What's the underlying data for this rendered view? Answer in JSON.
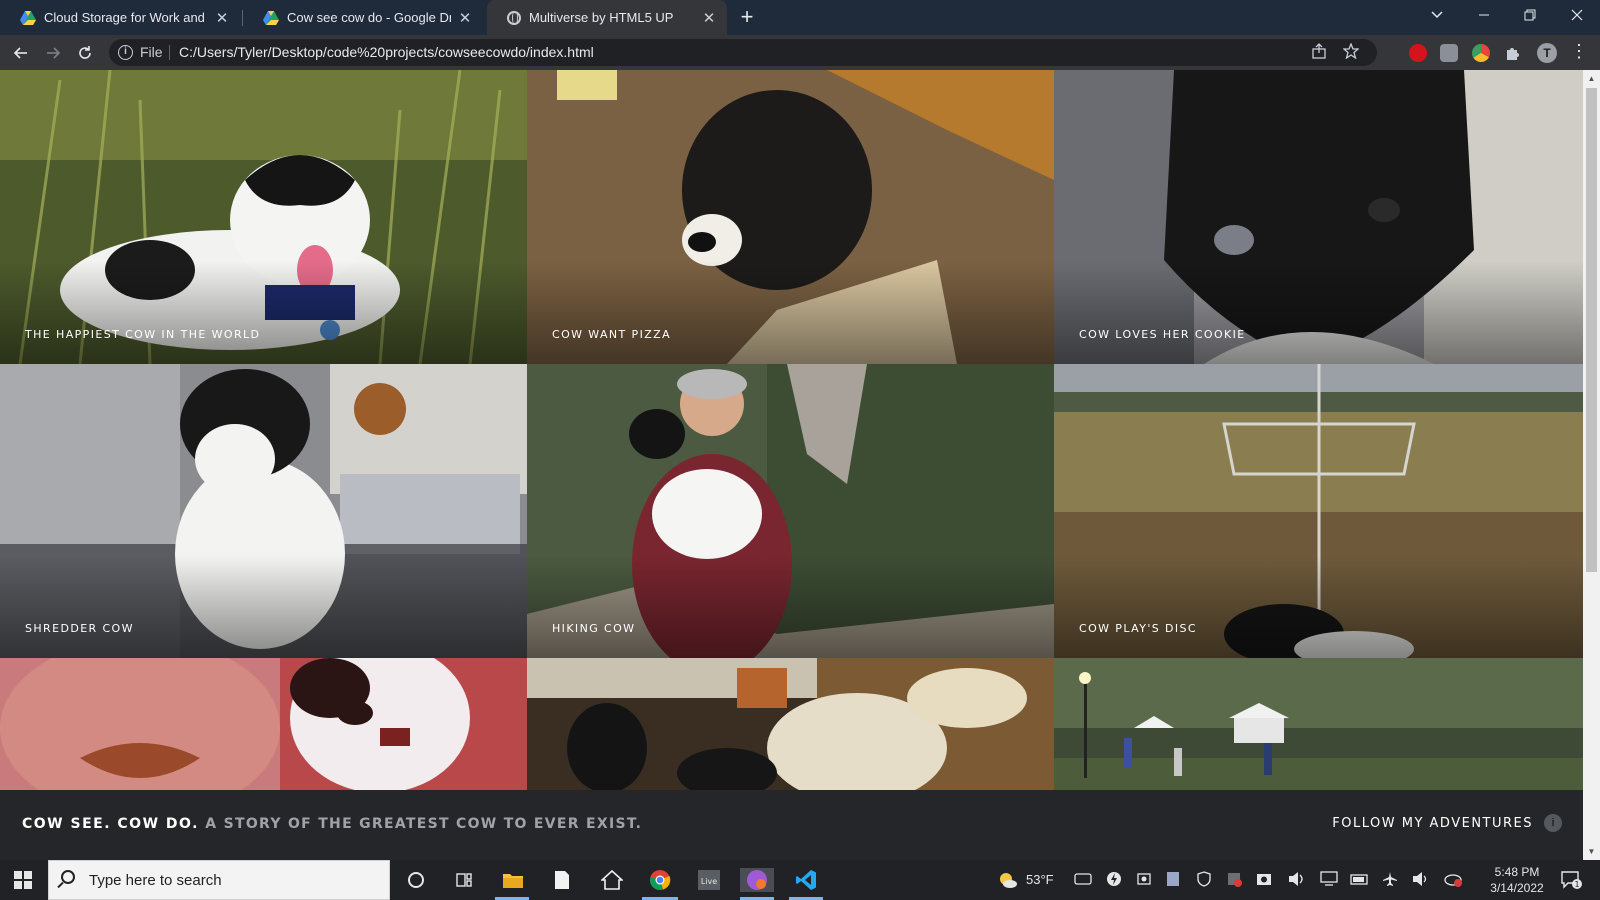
{
  "browser": {
    "tabs": [
      {
        "label": "Cloud Storage for Work and Home",
        "icon": "google-drive-icon",
        "active": false
      },
      {
        "label": "Cow see cow do - Google Drive",
        "icon": "google-drive-icon",
        "active": false
      },
      {
        "label": "Multiverse by HTML5 UP",
        "icon": "globe-icon",
        "active": true
      }
    ],
    "close_glyph": "✕",
    "new_tab_glyph": "+",
    "omnibox": {
      "scheme_label": "File",
      "url": "C:/Users/Tyler/Desktop/code%20projects/cowseecowdo/index.html"
    },
    "profile_initial": "T"
  },
  "site": {
    "title": "COW SEE. COW DO.",
    "subtitle": "A STORY OF THE GREATEST COW TO EVER EXIST.",
    "follow_label": "FOLLOW MY ADVENTURES",
    "follow_icon": "i"
  },
  "gallery": [
    {
      "caption": "THE HAPPIEST COW IN THE WORLD"
    },
    {
      "caption": "COW WANT PIZZA"
    },
    {
      "caption": "COW LOVES HER COOKIE"
    },
    {
      "caption": "SHREDDER COW"
    },
    {
      "caption": "HIKING COW"
    },
    {
      "caption": "COW PLAY'S DISC"
    },
    {
      "caption": ""
    },
    {
      "caption": ""
    },
    {
      "caption": ""
    }
  ],
  "taskbar": {
    "search_placeholder": "Type here to search",
    "weather": "53°F",
    "time": "5:48 PM",
    "date": "3/14/2022",
    "notification_count": "1"
  },
  "colors": {
    "tab_strip": "#1f2a3a",
    "toolbar": "#35363a",
    "page_bg": "#242629",
    "accent": "#7fb4ef"
  }
}
